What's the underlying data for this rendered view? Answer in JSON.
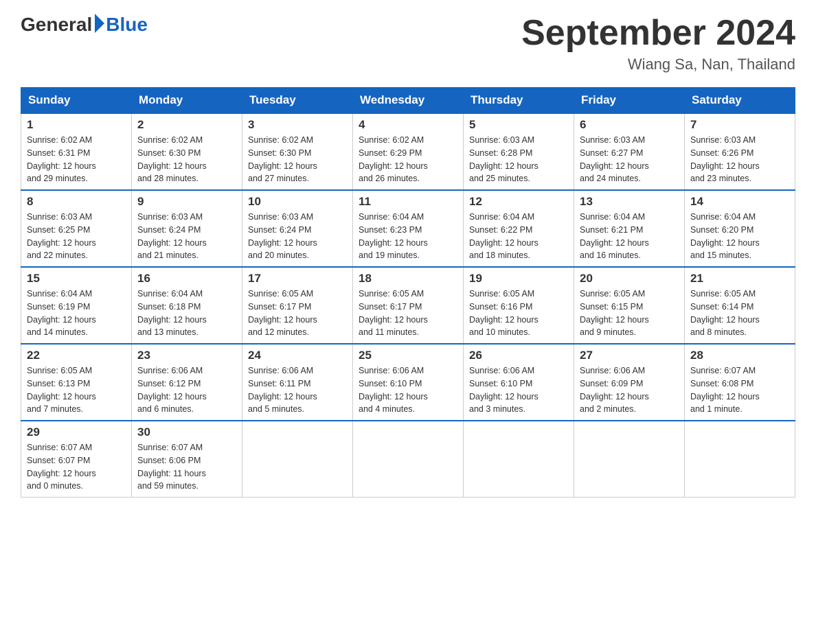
{
  "logo": {
    "general": "General",
    "blue": "Blue"
  },
  "header": {
    "month_year": "September 2024",
    "location": "Wiang Sa, Nan, Thailand"
  },
  "days_of_week": [
    "Sunday",
    "Monday",
    "Tuesday",
    "Wednesday",
    "Thursday",
    "Friday",
    "Saturday"
  ],
  "weeks": [
    [
      {
        "num": "1",
        "sunrise": "6:02 AM",
        "sunset": "6:31 PM",
        "daylight": "12 hours and 29 minutes."
      },
      {
        "num": "2",
        "sunrise": "6:02 AM",
        "sunset": "6:30 PM",
        "daylight": "12 hours and 28 minutes."
      },
      {
        "num": "3",
        "sunrise": "6:02 AM",
        "sunset": "6:30 PM",
        "daylight": "12 hours and 27 minutes."
      },
      {
        "num": "4",
        "sunrise": "6:02 AM",
        "sunset": "6:29 PM",
        "daylight": "12 hours and 26 minutes."
      },
      {
        "num": "5",
        "sunrise": "6:03 AM",
        "sunset": "6:28 PM",
        "daylight": "12 hours and 25 minutes."
      },
      {
        "num": "6",
        "sunrise": "6:03 AM",
        "sunset": "6:27 PM",
        "daylight": "12 hours and 24 minutes."
      },
      {
        "num": "7",
        "sunrise": "6:03 AM",
        "sunset": "6:26 PM",
        "daylight": "12 hours and 23 minutes."
      }
    ],
    [
      {
        "num": "8",
        "sunrise": "6:03 AM",
        "sunset": "6:25 PM",
        "daylight": "12 hours and 22 minutes."
      },
      {
        "num": "9",
        "sunrise": "6:03 AM",
        "sunset": "6:24 PM",
        "daylight": "12 hours and 21 minutes."
      },
      {
        "num": "10",
        "sunrise": "6:03 AM",
        "sunset": "6:24 PM",
        "daylight": "12 hours and 20 minutes."
      },
      {
        "num": "11",
        "sunrise": "6:04 AM",
        "sunset": "6:23 PM",
        "daylight": "12 hours and 19 minutes."
      },
      {
        "num": "12",
        "sunrise": "6:04 AM",
        "sunset": "6:22 PM",
        "daylight": "12 hours and 18 minutes."
      },
      {
        "num": "13",
        "sunrise": "6:04 AM",
        "sunset": "6:21 PM",
        "daylight": "12 hours and 16 minutes."
      },
      {
        "num": "14",
        "sunrise": "6:04 AM",
        "sunset": "6:20 PM",
        "daylight": "12 hours and 15 minutes."
      }
    ],
    [
      {
        "num": "15",
        "sunrise": "6:04 AM",
        "sunset": "6:19 PM",
        "daylight": "12 hours and 14 minutes."
      },
      {
        "num": "16",
        "sunrise": "6:04 AM",
        "sunset": "6:18 PM",
        "daylight": "12 hours and 13 minutes."
      },
      {
        "num": "17",
        "sunrise": "6:05 AM",
        "sunset": "6:17 PM",
        "daylight": "12 hours and 12 minutes."
      },
      {
        "num": "18",
        "sunrise": "6:05 AM",
        "sunset": "6:17 PM",
        "daylight": "12 hours and 11 minutes."
      },
      {
        "num": "19",
        "sunrise": "6:05 AM",
        "sunset": "6:16 PM",
        "daylight": "12 hours and 10 minutes."
      },
      {
        "num": "20",
        "sunrise": "6:05 AM",
        "sunset": "6:15 PM",
        "daylight": "12 hours and 9 minutes."
      },
      {
        "num": "21",
        "sunrise": "6:05 AM",
        "sunset": "6:14 PM",
        "daylight": "12 hours and 8 minutes."
      }
    ],
    [
      {
        "num": "22",
        "sunrise": "6:05 AM",
        "sunset": "6:13 PM",
        "daylight": "12 hours and 7 minutes."
      },
      {
        "num": "23",
        "sunrise": "6:06 AM",
        "sunset": "6:12 PM",
        "daylight": "12 hours and 6 minutes."
      },
      {
        "num": "24",
        "sunrise": "6:06 AM",
        "sunset": "6:11 PM",
        "daylight": "12 hours and 5 minutes."
      },
      {
        "num": "25",
        "sunrise": "6:06 AM",
        "sunset": "6:10 PM",
        "daylight": "12 hours and 4 minutes."
      },
      {
        "num": "26",
        "sunrise": "6:06 AM",
        "sunset": "6:10 PM",
        "daylight": "12 hours and 3 minutes."
      },
      {
        "num": "27",
        "sunrise": "6:06 AM",
        "sunset": "6:09 PM",
        "daylight": "12 hours and 2 minutes."
      },
      {
        "num": "28",
        "sunrise": "6:07 AM",
        "sunset": "6:08 PM",
        "daylight": "12 hours and 1 minute."
      }
    ],
    [
      {
        "num": "29",
        "sunrise": "6:07 AM",
        "sunset": "6:07 PM",
        "daylight": "12 hours and 0 minutes."
      },
      {
        "num": "30",
        "sunrise": "6:07 AM",
        "sunset": "6:06 PM",
        "daylight": "11 hours and 59 minutes."
      },
      null,
      null,
      null,
      null,
      null
    ]
  ],
  "labels": {
    "sunrise": "Sunrise:",
    "sunset": "Sunset:",
    "daylight": "Daylight:"
  }
}
